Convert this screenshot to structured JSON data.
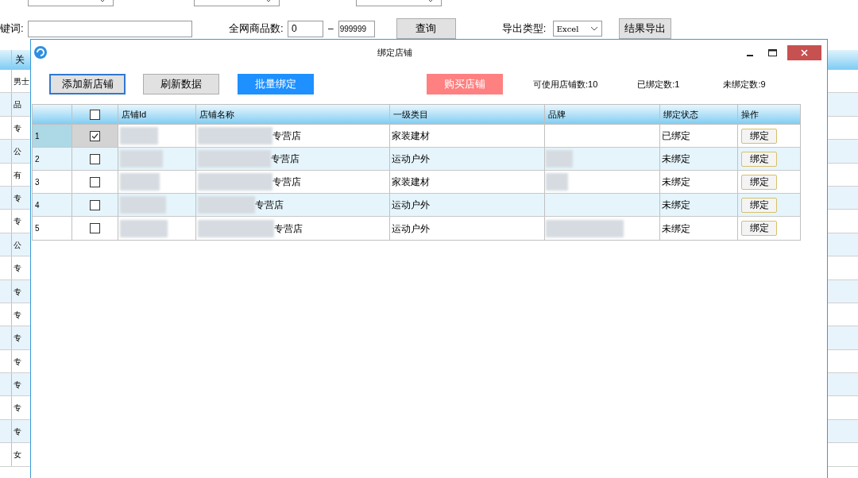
{
  "background_form": {
    "keyword_label": "键词:",
    "count_label": "全网商品数:",
    "count_min": "0",
    "dash": "–",
    "count_max": "999999",
    "query_button": "查询",
    "export_label": "导出类型:",
    "export_type": "Excel",
    "export_button": "结果导出"
  },
  "background_table": {
    "header": "关",
    "rows": [
      "男士",
      "品",
      "专",
      "公",
      "有",
      "专",
      "专",
      "公",
      "专",
      "专",
      "专",
      "专",
      "专",
      "专",
      "专",
      "专",
      "女"
    ]
  },
  "dialog": {
    "title": "绑定店铺",
    "buttons": [
      {
        "label": "添加新店铺",
        "kind": "focused"
      },
      {
        "label": "刷新数据",
        "kind": "normal"
      },
      {
        "label": "批量绑定",
        "kind": "primary"
      },
      {
        "label": "购买店铺",
        "kind": "danger"
      }
    ],
    "stats": [
      "可使用店铺数:10",
      "已绑定数:1",
      "未绑定数:9"
    ],
    "table": {
      "header_checked": false,
      "columns": [
        "店铺Id",
        "店铺名称",
        "一级类目",
        "品牌",
        "绑定状态",
        "操作"
      ],
      "rows": [
        {
          "index": "1",
          "selected": true,
          "checked": true,
          "name_suffix": "专营店",
          "category": "家装建材",
          "brand_blurred": false,
          "status": "已绑定",
          "action": "绑定"
        },
        {
          "index": "2",
          "selected": false,
          "checked": false,
          "name_suffix": "专营店",
          "category": "运动户外",
          "brand_blurred": true,
          "status": "未绑定",
          "action": "绑定"
        },
        {
          "index": "3",
          "selected": false,
          "checked": false,
          "name_suffix": "专营店",
          "category": "家装建材",
          "brand_blurred": true,
          "status": "未绑定",
          "action": "绑定"
        },
        {
          "index": "4",
          "selected": false,
          "checked": false,
          "name_suffix": "专营店",
          "category": "运动户外",
          "brand_blurred": false,
          "status": "未绑定",
          "action": "绑定"
        },
        {
          "index": "5",
          "selected": false,
          "checked": false,
          "name_suffix": "专营店",
          "category": "运动户外",
          "brand_blurred": true,
          "status": "未绑定",
          "action": "绑定"
        }
      ]
    }
  }
}
